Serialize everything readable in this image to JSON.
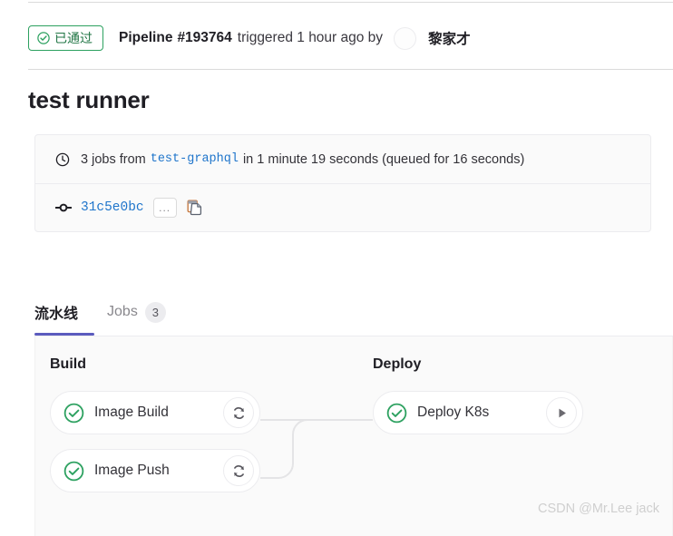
{
  "header": {
    "status_badge": {
      "icon": "check-circle-icon",
      "label": "已通过",
      "color": "#217645",
      "border_color": "#2da160"
    },
    "pipeline_label": "Pipeline",
    "pipeline_number": "#193764",
    "triggered_text": "triggered 1 hour ago by",
    "author": "黎家才",
    "avatar_icon": "user-avatar-icon"
  },
  "page_title": "test runner",
  "info_card": {
    "duration_row": {
      "icon": "clock-icon",
      "prefix": "3 jobs from",
      "ref": "test-graphql",
      "suffix": "in 1 minute 19 seconds (queued for 16 seconds)"
    },
    "commit_row": {
      "icon": "commit-icon",
      "sha": "31c5e0bc",
      "ellipsis_label": "...",
      "copy_icon": "copy-icon"
    }
  },
  "tabs": [
    {
      "label": "流水线",
      "active": true,
      "badge": null
    },
    {
      "label": "Jobs",
      "active": false,
      "badge": "3"
    }
  ],
  "pipeline": {
    "accent_color": "#5b5bbe",
    "success_color": "#2da160",
    "stages": [
      {
        "name": "Build",
        "jobs": [
          {
            "name": "Image Build",
            "status": "success",
            "status_icon": "check-circle-icon",
            "action": "retry",
            "action_icon": "retry-icon"
          },
          {
            "name": "Image Push",
            "status": "success",
            "status_icon": "check-circle-icon",
            "action": "retry",
            "action_icon": "retry-icon"
          }
        ]
      },
      {
        "name": "Deploy",
        "jobs": [
          {
            "name": "Deploy K8s",
            "status": "success",
            "status_icon": "check-circle-icon",
            "action": "play",
            "action_icon": "play-icon"
          }
        ]
      }
    ]
  },
  "watermark": "CSDN @Mr.Lee jack"
}
